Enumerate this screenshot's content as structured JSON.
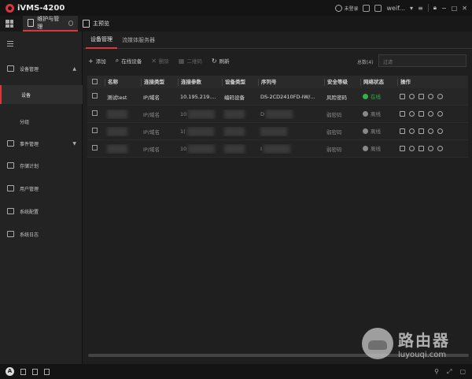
{
  "app": {
    "title": "iVMS-4200"
  },
  "titlebar": {
    "cloud_label": "未登录",
    "user_label": "weif..."
  },
  "main_tabs": [
    {
      "label": "维护与管理"
    },
    {
      "label": "主预览"
    }
  ],
  "sidebar": {
    "items": [
      {
        "label": "设备管理",
        "icon": "device-manage-icon"
      },
      {
        "label": "设备"
      },
      {
        "label": "分组"
      },
      {
        "label": "事件管理",
        "icon": "event-icon"
      },
      {
        "label": "存储计划",
        "icon": "storage-icon"
      },
      {
        "label": "用户管理",
        "icon": "user-icon"
      },
      {
        "label": "系统配置",
        "icon": "settings-icon"
      },
      {
        "label": "系统日志",
        "icon": "log-icon"
      }
    ]
  },
  "subtabs": [
    {
      "label": "设备管理"
    },
    {
      "label": "流媒体服务器"
    }
  ],
  "toolbar": {
    "add": "添加",
    "online": "在线设备",
    "delete": "删除",
    "qrcode": "二维码",
    "refresh": "刷新",
    "total": "总数(4)",
    "filter_placeholder": "过滤"
  },
  "table": {
    "headers": [
      "名称",
      "连接类型",
      "连接参数",
      "设备类型",
      "序列号",
      "安全等级",
      "网络状态",
      "操作"
    ],
    "rows": [
      {
        "name": "测试test",
        "conn_type": "IP/域名",
        "conn_param": "10.195.219....",
        "dev_type": "编码设备",
        "serial": "DS-2CD2410FD-IW/...",
        "security": "风险密码",
        "status": "在线"
      },
      {
        "name": "",
        "conn_type": "IP/域名",
        "conn_param": "10",
        "dev_type": "",
        "serial": "D",
        "security": "弱密码",
        "status": "离线"
      },
      {
        "name": "",
        "conn_type": "IP/域名",
        "conn_param": "1(",
        "dev_type": "",
        "serial": "",
        "security": "弱密码",
        "status": "离线"
      },
      {
        "name": "",
        "conn_type": "IP/域名",
        "conn_param": "10",
        "dev_type": "",
        "serial": "I",
        "security": "弱密码",
        "status": "离线"
      }
    ]
  },
  "watermark": {
    "cn": "路由器",
    "url": "luyouqi.com"
  },
  "colors": {
    "accent": "#d9363e",
    "online": "#2fb344",
    "offline": "#888888"
  }
}
